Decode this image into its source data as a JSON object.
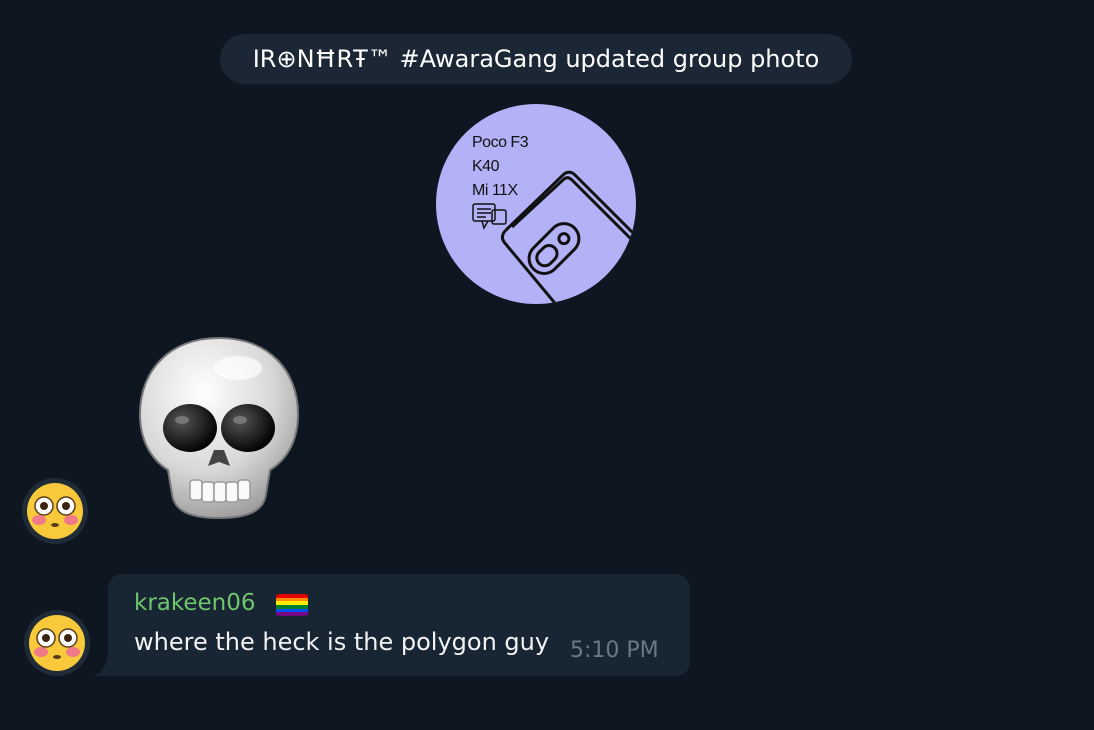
{
  "service_message": {
    "text": "IR⊕NĦRŦ™ #AwaraGang updated group photo"
  },
  "group_photo": {
    "lines": [
      "Poco F3",
      "K40",
      "Mi 11X"
    ],
    "background": "#b4b2f7"
  },
  "sticker": {
    "emoji": "skull"
  },
  "message": {
    "sender": "krakeen06",
    "sender_badge": "rainbow-flag",
    "text": "where the heck is the polygon guy",
    "time": "5:10 PM"
  },
  "colors": {
    "background": "#0e1621",
    "bubble": "#182533",
    "sender_name": "#6fc66b",
    "time": "#6c7883"
  }
}
